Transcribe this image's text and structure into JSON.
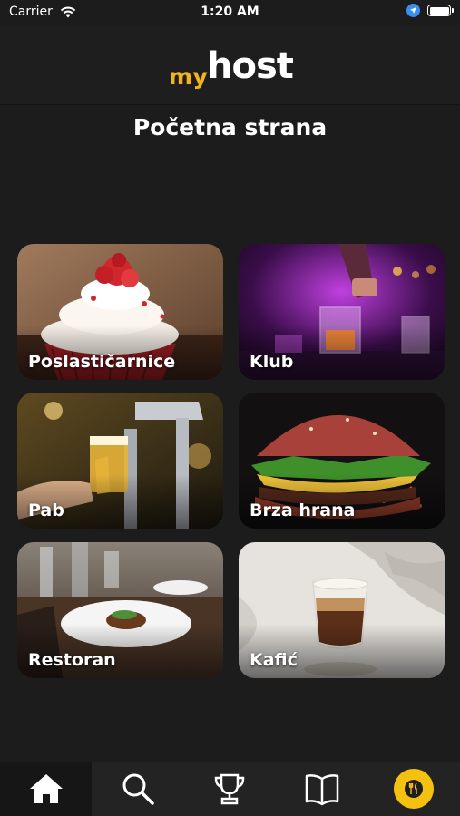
{
  "status_bar": {
    "carrier": "Carrier",
    "time": "1:20 AM"
  },
  "header": {
    "logo_my": "my",
    "logo_host": "host"
  },
  "page": {
    "title": "Početna strana"
  },
  "categories": [
    {
      "label": "Poslastičarnice",
      "image": "red-velvet-cupcake"
    },
    {
      "label": "Klub",
      "image": "bartender-cocktail-purple"
    },
    {
      "label": "Pab",
      "image": "beer-tap-glass"
    },
    {
      "label": "Brza hrana",
      "image": "burger"
    },
    {
      "label": "Restoran",
      "image": "plated-dish-restaurant"
    },
    {
      "label": "Kafić",
      "image": "espresso-glass"
    }
  ],
  "bottom_nav": [
    {
      "name": "home",
      "icon": "home-icon",
      "active": true
    },
    {
      "name": "search",
      "icon": "search-icon",
      "active": false
    },
    {
      "name": "trophy",
      "icon": "trophy-icon",
      "active": false
    },
    {
      "name": "book",
      "icon": "book-icon",
      "active": false
    },
    {
      "name": "profile",
      "icon": "fork-knife-avatar-icon",
      "active": false
    }
  ],
  "colors": {
    "accent": "#f5c10f",
    "logo_my": "#f3b41a",
    "background": "#1c1c1d"
  }
}
